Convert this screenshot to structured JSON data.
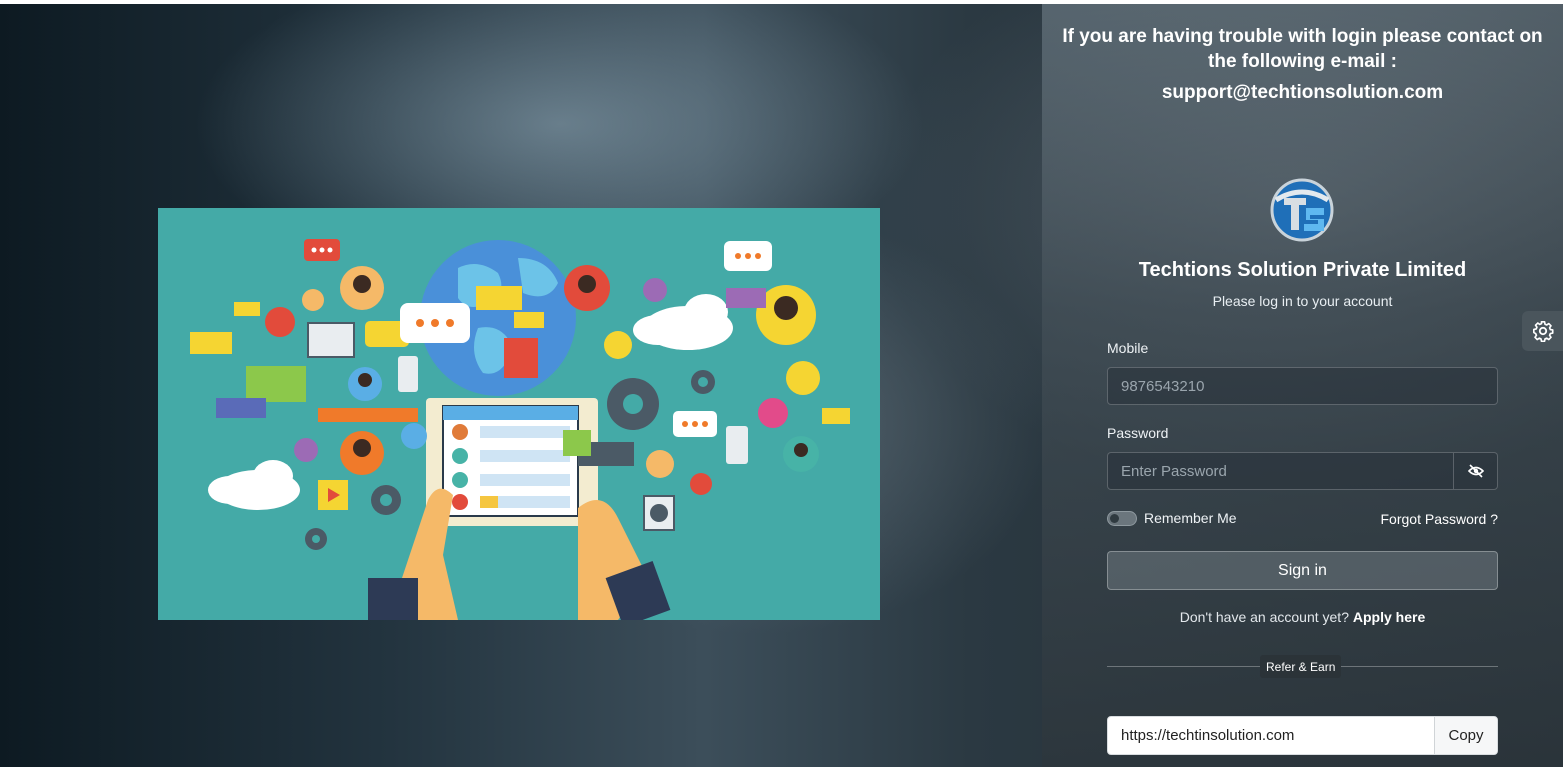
{
  "support": {
    "message": "If you are having trouble with login please contact on the following e-mail :",
    "email": "support@techtionsolution.com"
  },
  "brand": {
    "logo_icon": "ts-logo-icon",
    "company_name": "Techtions Solution Private Limited",
    "subtitle": "Please log in to your account"
  },
  "form": {
    "mobile_label": "Mobile",
    "mobile_placeholder": "9876543210",
    "password_label": "Password",
    "password_placeholder": "Enter Password",
    "password_toggle_icon": "eye-slash-icon",
    "remember_label": "Remember Me",
    "remember_checked": false,
    "forgot_label": "Forgot Password ?",
    "signin_label": "Sign in",
    "no_account_text": "Don't have an account yet?",
    "apply_label": "Apply here"
  },
  "refer": {
    "badge": "Refer & Earn",
    "url": "https://techtinsolution.com",
    "copy_label": "Copy"
  },
  "settings": {
    "icon": "gear-icon"
  },
  "colors": {
    "hero_bg": "#44aaa7",
    "ref_box_bg": "#ffffff"
  }
}
